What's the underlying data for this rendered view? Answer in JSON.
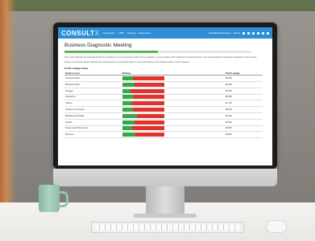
{
  "nav": {
    "logo_main": "CONSULT",
    "logo_x": "X",
    "links": [
      "Companies",
      "CRM",
      "Training",
      "Resources"
    ],
    "user": "Mowalie Macesprovi",
    "admin": "Admin"
  },
  "page": {
    "title": "Business Diagnostic Meeting",
    "progress_fraction": 0.5,
    "description_1": "This report indicates the potential profit that is leaking out of your business today and is available to you by working with a Business Success Partner, and implementing the strategies developed in this process.",
    "description_2": "Please note that the values indicated are potential only, and could be higher or lower depending on the actual situation of your business.",
    "section_title": "Profit Leakage Value"
  },
  "table": {
    "headers": [
      "Business Area",
      "Ranking",
      "Profit Leakage"
    ],
    "rows": [
      {
        "area": "Generate Sales",
        "rank": 0.25,
        "value": "$3,895"
      },
      {
        "area": "Business Vision",
        "rank": 0.3,
        "value": "$8,200"
      },
      {
        "area": "Strategy",
        "rank": 0.2,
        "value": "$4,750"
      },
      {
        "area": "Operations",
        "rank": 0.28,
        "value": "$2,820"
      },
      {
        "area": "Culture",
        "rank": 0.22,
        "value": "$1,700"
      },
      {
        "area": "Products or Services",
        "rank": 0.26,
        "value": "$5,200"
      },
      {
        "area": "Marketing and Sales",
        "rank": 0.35,
        "value": "$3,420"
      },
      {
        "area": "Growth",
        "rank": 0.3,
        "value": "$4,000"
      },
      {
        "area": "Systems and Processes",
        "rank": 0.24,
        "value": "$2,835"
      },
      {
        "area": "Business",
        "rank": 0.32,
        "value": "$3,820"
      }
    ]
  }
}
